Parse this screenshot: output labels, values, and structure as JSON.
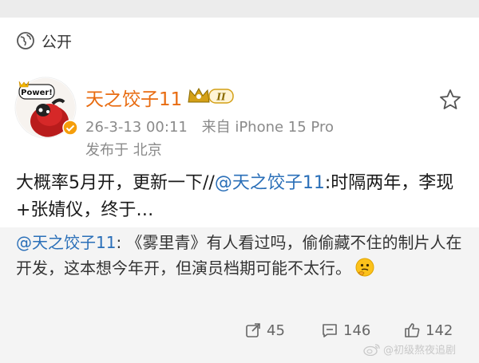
{
  "visibility": {
    "label": "公开",
    "icon": "globe-icon"
  },
  "user": {
    "name": "天之饺子11",
    "avatar_text": "Power!",
    "level_badge": "II",
    "level_badge_color": "#c9a227"
  },
  "meta": {
    "time": "26-3-13 00:11",
    "source": "来自 iPhone 15 Pro",
    "location": "发布于 北京"
  },
  "post": {
    "text_prefix": "大概率5月开，更新一下//",
    "mention": "@天之饺子11",
    "text_suffix": ":时隔两年，李现+张婧仪，终于…"
  },
  "repost": {
    "mention": "@天之饺子11",
    "text": ": 《雾里青》有人看过吗，偷偷藏不住的制片人在开发，这本想今年开，但演员档期可能不太行。",
    "emoji": "thinking-face"
  },
  "actions": {
    "reposts": "45",
    "comments": "146",
    "likes": "142"
  },
  "watermark": "@初级熬夜追剧",
  "colors": {
    "username": "#e86b10",
    "mention": "#2a6fb8",
    "repost_bg": "#f4f4f4"
  }
}
